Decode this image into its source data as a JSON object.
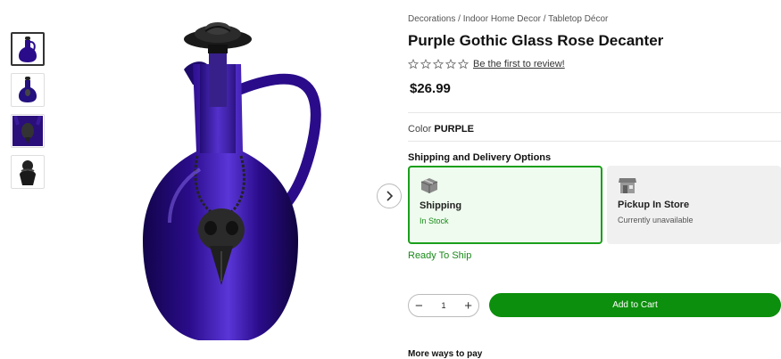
{
  "breadcrumb": [
    "Decorations",
    "Indoor Home Decor",
    "Tabletop Décor"
  ],
  "breadcrumb_separator": " / ",
  "product": {
    "title": "Purple Gothic Glass Rose Decanter",
    "price": "$26.99",
    "review_link": "Be the first to review!",
    "rating": 0,
    "rating_max": 5
  },
  "color": {
    "label": "Color",
    "value": "PURPLE"
  },
  "shipping": {
    "heading": "Shipping and Delivery Options",
    "options": [
      {
        "title": "Shipping",
        "status": "In Stock",
        "selected": true,
        "icon": "package-icon"
      },
      {
        "title": "Pickup In Store",
        "status": "Currently unavailable",
        "selected": false,
        "icon": "store-icon"
      }
    ],
    "ready_text": "Ready To Ship"
  },
  "quantity": {
    "value": "1",
    "minus": "−",
    "plus": "+"
  },
  "cart": {
    "label": "Add to Cart"
  },
  "more_ways": "More ways to pay",
  "colors": {
    "accent": "#0c8f0c",
    "decanter": "#2a0c8a",
    "selected_bg": "#eefbee"
  },
  "thumbnails": [
    {
      "name": "decanter-front",
      "active": true
    },
    {
      "name": "decanter-full",
      "active": false
    },
    {
      "name": "decanter-detail",
      "active": false
    },
    {
      "name": "decanter-pendant",
      "active": false
    }
  ]
}
